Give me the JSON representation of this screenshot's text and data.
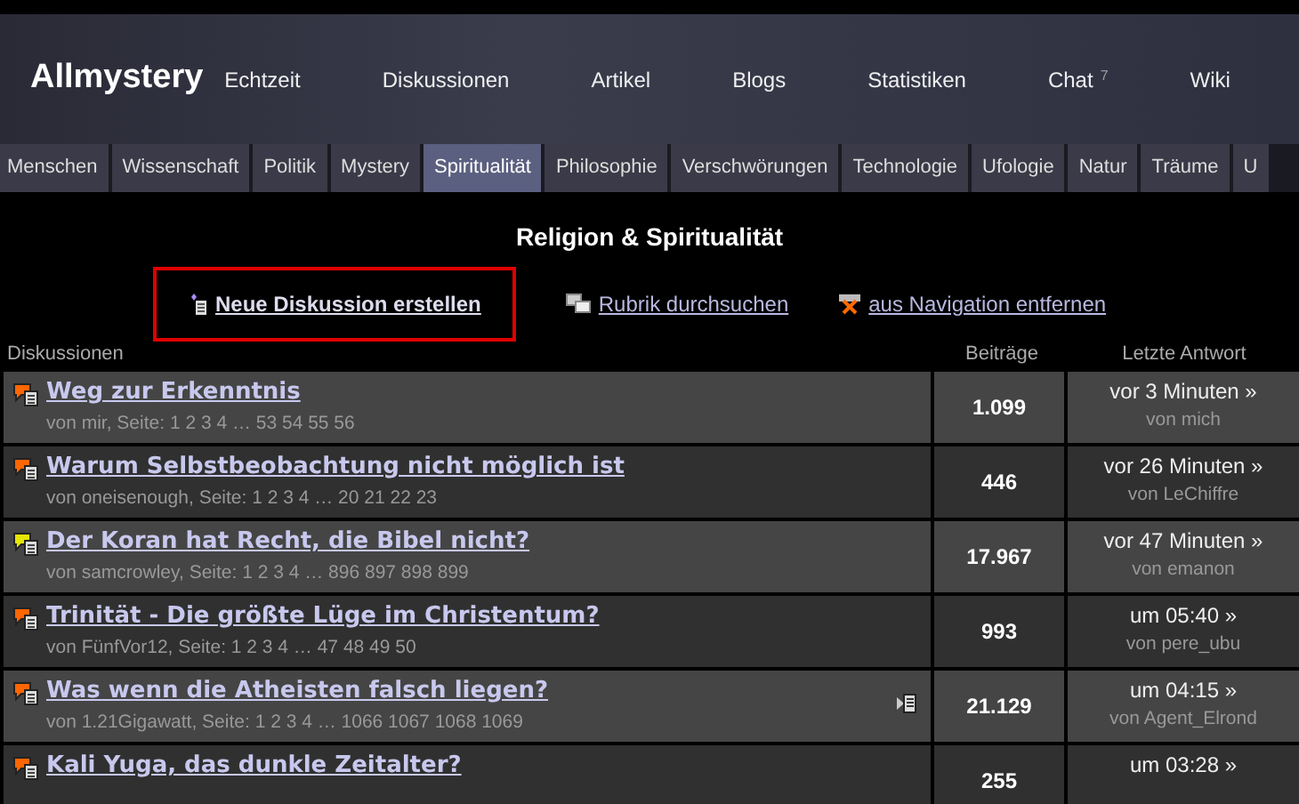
{
  "header": {
    "logo": "Allmystery",
    "nav": [
      {
        "label": "Echtzeit"
      },
      {
        "label": "Diskussionen"
      },
      {
        "label": "Artikel"
      },
      {
        "label": "Blogs"
      },
      {
        "label": "Statistiken"
      },
      {
        "label": "Chat",
        "badge": "7"
      },
      {
        "label": "Wiki"
      }
    ]
  },
  "categories": [
    {
      "label": "Menschen",
      "selected": false
    },
    {
      "label": "Wissenschaft",
      "selected": false
    },
    {
      "label": "Politik",
      "selected": false
    },
    {
      "label": "Mystery",
      "selected": false
    },
    {
      "label": "Spiritualität",
      "selected": true
    },
    {
      "label": "Philosophie",
      "selected": false
    },
    {
      "label": "Verschwörungen",
      "selected": false
    },
    {
      "label": "Technologie",
      "selected": false
    },
    {
      "label": "Ufologie",
      "selected": false
    },
    {
      "label": "Natur",
      "selected": false
    },
    {
      "label": "Träume",
      "selected": false
    },
    {
      "label": "U",
      "selected": false
    }
  ],
  "page_title": "Religion & Spiritualität",
  "actions": [
    {
      "kind": "new",
      "label": "Neue Diskussion erstellen",
      "highlighted": true
    },
    {
      "kind": "search",
      "label": "Rubrik durchsuchen",
      "highlighted": false
    },
    {
      "kind": "remove",
      "label": "aus Navigation entfernen",
      "highlighted": false
    }
  ],
  "table": {
    "columns": [
      "Diskussionen",
      "Beiträge",
      "Letzte Antwort"
    ],
    "rows": [
      {
        "title": "Weg zur Erkenntnis",
        "meta": "von mir, Seite: 1 2 3 4 … 53 54 55 56",
        "color": "#ff6600",
        "posts": "1.099",
        "last": "vor 3 Minuten »",
        "last_by": "von mich",
        "note_icon": false
      },
      {
        "title": "Warum Selbstbeobachtung nicht möglich ist",
        "meta": "von oneisenough, Seite: 1 2 3 4 … 20 21 22 23",
        "color": "#ff6600",
        "posts": "446",
        "last": "vor 26 Minuten »",
        "last_by": "von LeChiffre",
        "note_icon": false
      },
      {
        "title": "Der Koran hat Recht, die Bibel nicht?",
        "meta": "von samcrowley, Seite: 1 2 3 4 … 896 897 898 899",
        "color": "#e6e600",
        "posts": "17.967",
        "last": "vor 47 Minuten »",
        "last_by": "von emanon",
        "note_icon": false
      },
      {
        "title": "Trinität - Die größte Lüge im Christentum?",
        "meta": "von FünfVor12, Seite: 1 2 3 4 … 47 48 49 50",
        "color": "#ff6600",
        "posts": "993",
        "last": "um 05:40 »",
        "last_by": "von pere_ubu",
        "note_icon": false
      },
      {
        "title": "Was wenn die Atheisten falsch liegen?",
        "meta": "von 1.21Gigawatt, Seite: 1 2 3 4 … 1066 1067 1068 1069",
        "color": "#ff6600",
        "posts": "21.129",
        "last": "um 04:15 »",
        "last_by": "von Agent_Elrond",
        "note_icon": true
      },
      {
        "title": "Kali Yuga, das dunkle Zeitalter?",
        "color": "#ff6600",
        "posts": "255",
        "last": "um 03:28 »",
        "note_icon": false
      }
    ]
  }
}
